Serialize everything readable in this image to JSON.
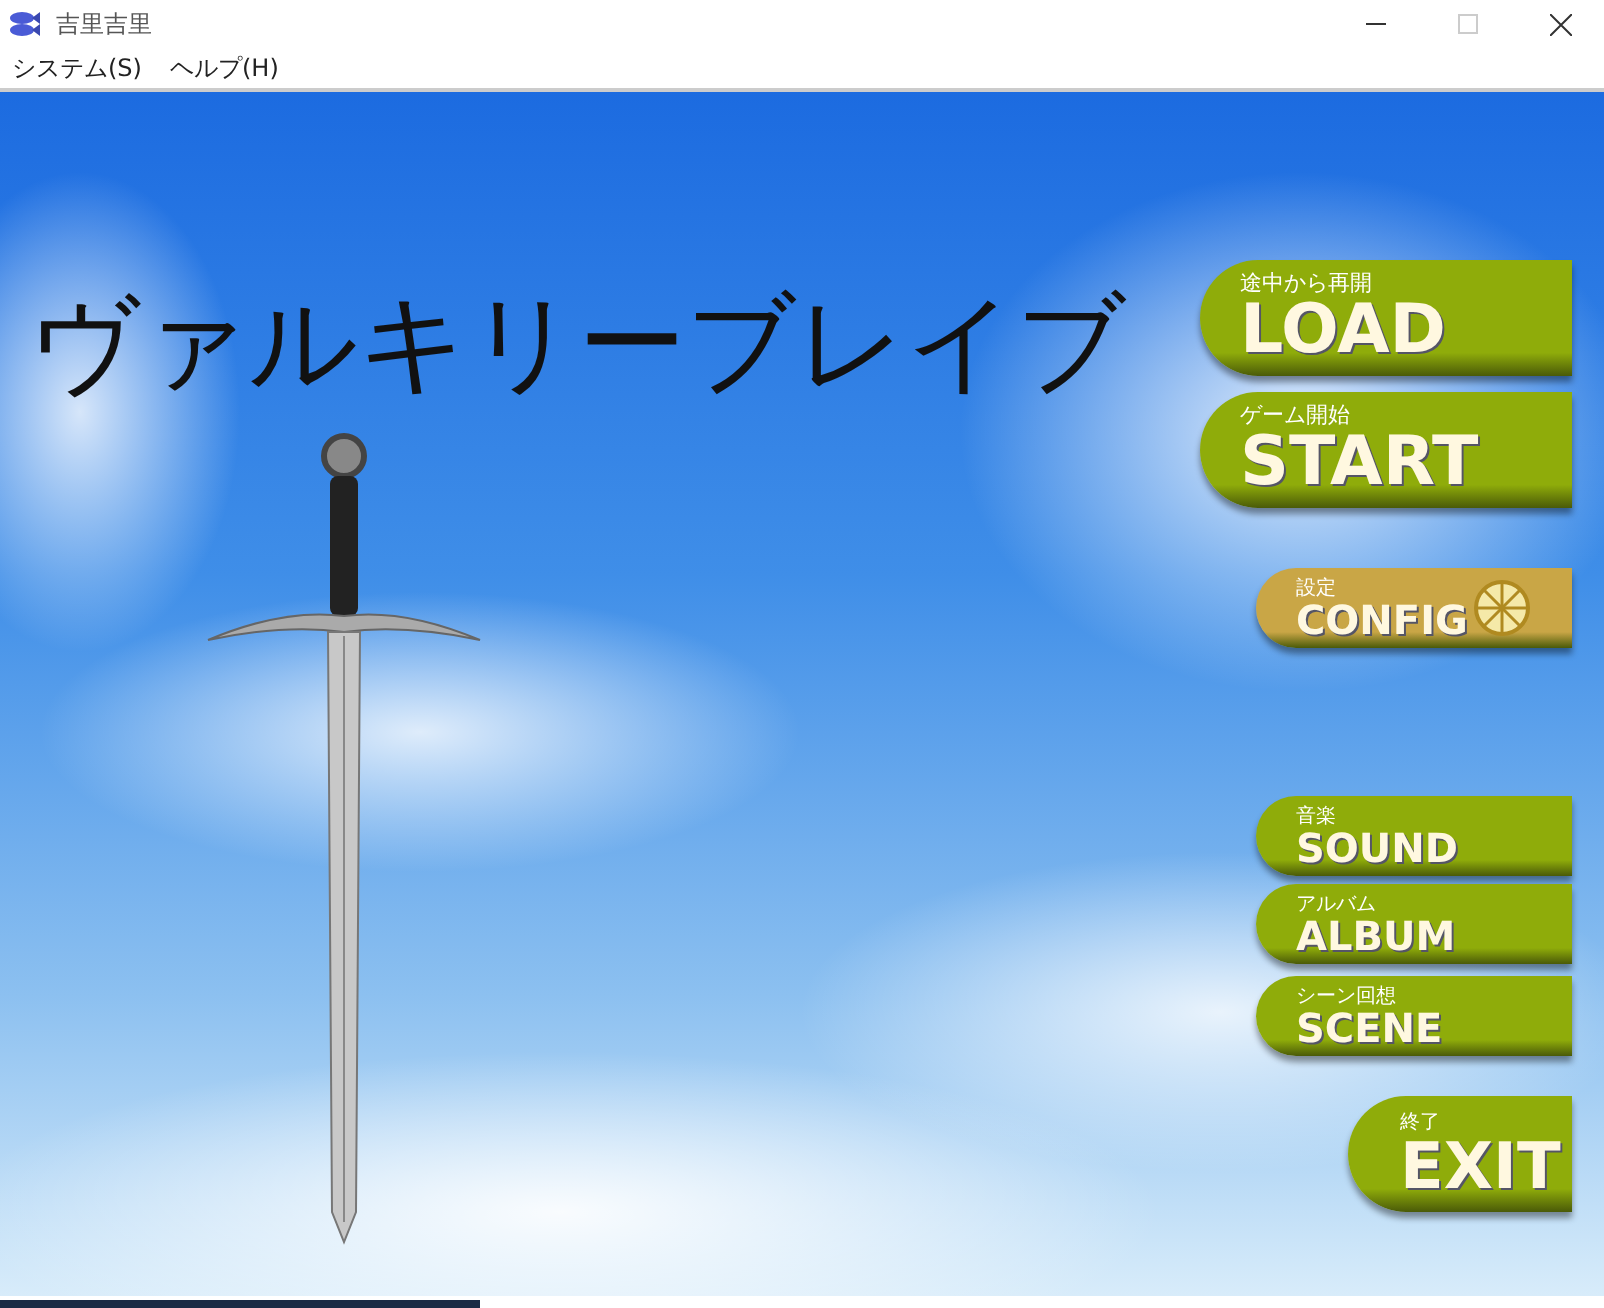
{
  "window": {
    "title": "吉里吉里"
  },
  "menu": [
    "システム(S)",
    "ヘルプ(H)"
  ],
  "game": {
    "title": "ヴァルキリーブレイブ",
    "buttons": [
      {
        "kind": "large",
        "color": "#8fac0a",
        "caption": "途中から再開",
        "label": "LOAD"
      },
      {
        "kind": "large",
        "color": "#8fac0a",
        "caption": "ゲーム開始",
        "label": "START"
      },
      {
        "kind": "config",
        "color": "#c9a646",
        "caption": "設定",
        "label": "CONFIG"
      },
      {
        "kind": "small",
        "color": "#8fac0a",
        "caption": "音楽",
        "label": "SOUND"
      },
      {
        "kind": "small",
        "color": "#8fac0a",
        "caption": "アルバム",
        "label": "ALBUM"
      },
      {
        "kind": "small",
        "color": "#8fac0a",
        "caption": "シーン回想",
        "label": "SCENE"
      },
      {
        "kind": "exit",
        "color": "#8fac0a",
        "caption": "終了",
        "label": "EXIT"
      }
    ]
  }
}
